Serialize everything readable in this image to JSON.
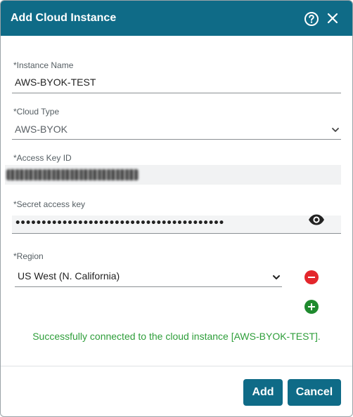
{
  "dialog": {
    "title": "Add Cloud Instance",
    "help_icon": "help-circle-icon",
    "close_icon": "close-icon"
  },
  "form": {
    "instance_name": {
      "label": "*Instance Name",
      "value": "AWS-BYOK-TEST"
    },
    "cloud_type": {
      "label": "*Cloud Type",
      "value": "AWS-BYOK"
    },
    "access_key_id": {
      "label": "*Access Key ID"
    },
    "secret_access_key": {
      "label": "*Secret access key",
      "masked_value": "••••••••••••••••••••••••••••••••••••••••"
    },
    "region": {
      "label": "*Region",
      "value": "US West (N. California)"
    }
  },
  "status": {
    "message": "Successfully connected to the cloud instance [AWS-BYOK-TEST].",
    "color": "#2e9e3a"
  },
  "footer": {
    "add_label": "Add",
    "cancel_label": "Cancel"
  },
  "colors": {
    "accent": "#0f6b87",
    "remove": "#e3262c",
    "add": "#1f8a2e"
  }
}
